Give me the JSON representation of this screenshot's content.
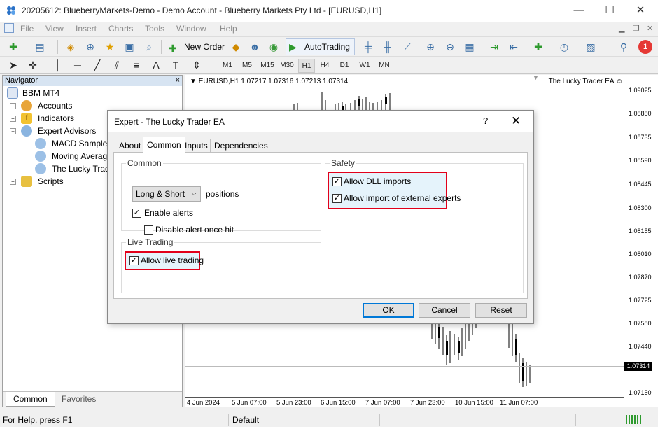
{
  "window": {
    "title": "20205612: BlueberryMarkets-Demo - Demo Account - Blueberry Markets Pty Ltd - [EURUSD,H1]",
    "minimize": "—",
    "maximize": "☐",
    "close": "✕"
  },
  "menu": [
    "File",
    "View",
    "Insert",
    "Charts",
    "Tools",
    "Window",
    "Help"
  ],
  "toolbar": {
    "new_order": "New Order",
    "autotrading": "AutoTrading",
    "notification_count": "1"
  },
  "timeframes": [
    "M1",
    "M5",
    "M15",
    "M30",
    "H1",
    "H4",
    "D1",
    "W1",
    "MN"
  ],
  "active_timeframe": "H1",
  "navigator": {
    "title": "Navigator",
    "close": "×",
    "root": "BBM MT4",
    "accounts": "Accounts",
    "indicators": "Indicators",
    "expert_advisors": "Expert Advisors",
    "ea_items": [
      "MACD Sample",
      "Moving Averag",
      "The Lucky Trad"
    ],
    "scripts": "Scripts",
    "tabs": [
      "Common",
      "Favorites"
    ]
  },
  "chart": {
    "header": "EURUSD,H1  1.07217 1.07316 1.07213 1.07314",
    "ea_label": "The Lucky Trader EA",
    "price_labels": [
      "1.09025",
      "1.08880",
      "1.08735",
      "1.08590",
      "1.08445",
      "1.08300",
      "1.08155",
      "1.08010",
      "1.07870",
      "1.07725",
      "1.07580",
      "1.07440",
      "1.07150"
    ],
    "current_price": "1.07314",
    "time_labels": [
      "4 Jun 2024",
      "5 Jun 07:00",
      "5 Jun 23:00",
      "6 Jun 15:00",
      "7 Jun 07:00",
      "7 Jun 23:00",
      "10 Jun 15:00",
      "11 Jun 07:00"
    ]
  },
  "status": {
    "help": "For Help, press F1",
    "profile": "Default"
  },
  "dialog": {
    "title": "Expert - The Lucky Trader EA",
    "help": "?",
    "close": "✕",
    "tabs": [
      "About",
      "Common",
      "Inputs",
      "Dependencies"
    ],
    "active_tab": "Common",
    "common_group": "Common",
    "positions_value": "Long & Short",
    "positions_label": "positions",
    "enable_alerts": "Enable alerts",
    "disable_alert": "Disable alert once hit",
    "live_group": "Live Trading",
    "allow_live": "Allow live trading",
    "safety_group": "Safety",
    "allow_dll": "Allow DLL imports",
    "allow_external": "Allow import of external experts",
    "ok": "OK",
    "cancel": "Cancel",
    "reset": "Reset"
  },
  "colors": {
    "highlight_border": "#e2001a",
    "highlight_fill": "#e5f3fb",
    "primary_button": "#0078d7",
    "nav_header": "#d7e4f2"
  }
}
